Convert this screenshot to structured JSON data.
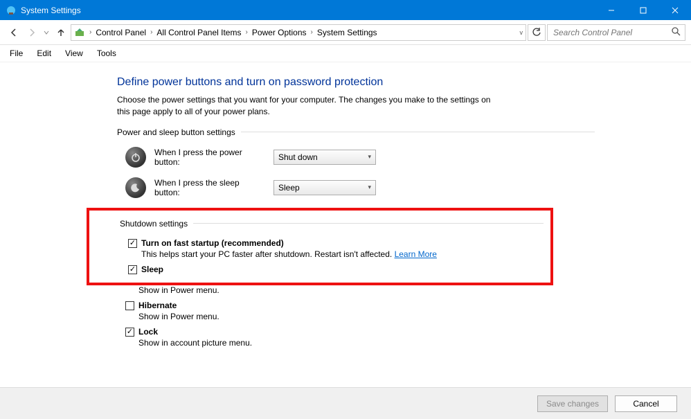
{
  "window": {
    "title": "System Settings"
  },
  "breadcrumb": {
    "items": [
      "Control Panel",
      "All Control Panel Items",
      "Power Options",
      "System Settings"
    ]
  },
  "search": {
    "placeholder": "Search Control Panel"
  },
  "menu": {
    "file": "File",
    "edit": "Edit",
    "view": "View",
    "tools": "Tools"
  },
  "page": {
    "title": "Define power buttons and turn on password protection",
    "desc": "Choose the power settings that you want for your computer. The changes you make to the settings on this page apply to all of your power plans.",
    "section_power_sleep": "Power and sleep button settings",
    "power_btn_label": "When I press the power button:",
    "power_btn_value": "Shut down",
    "sleep_btn_label": "When I press the sleep button:",
    "sleep_btn_value": "Sleep",
    "section_shutdown": "Shutdown settings",
    "fast_startup_label": "Turn on fast startup (recommended)",
    "fast_startup_desc": "This helps start your PC faster after shutdown. Restart isn't affected. ",
    "learn_more": "Learn More",
    "sleep_label": "Sleep",
    "sleep_desc": "Show in Power menu.",
    "hibernate_label": "Hibernate",
    "hibernate_desc": "Show in Power menu.",
    "lock_label": "Lock",
    "lock_desc": "Show in account picture menu."
  },
  "buttons": {
    "save": "Save changes",
    "cancel": "Cancel"
  },
  "checks": {
    "fast_startup": true,
    "sleep": true,
    "hibernate": false,
    "lock": true
  }
}
